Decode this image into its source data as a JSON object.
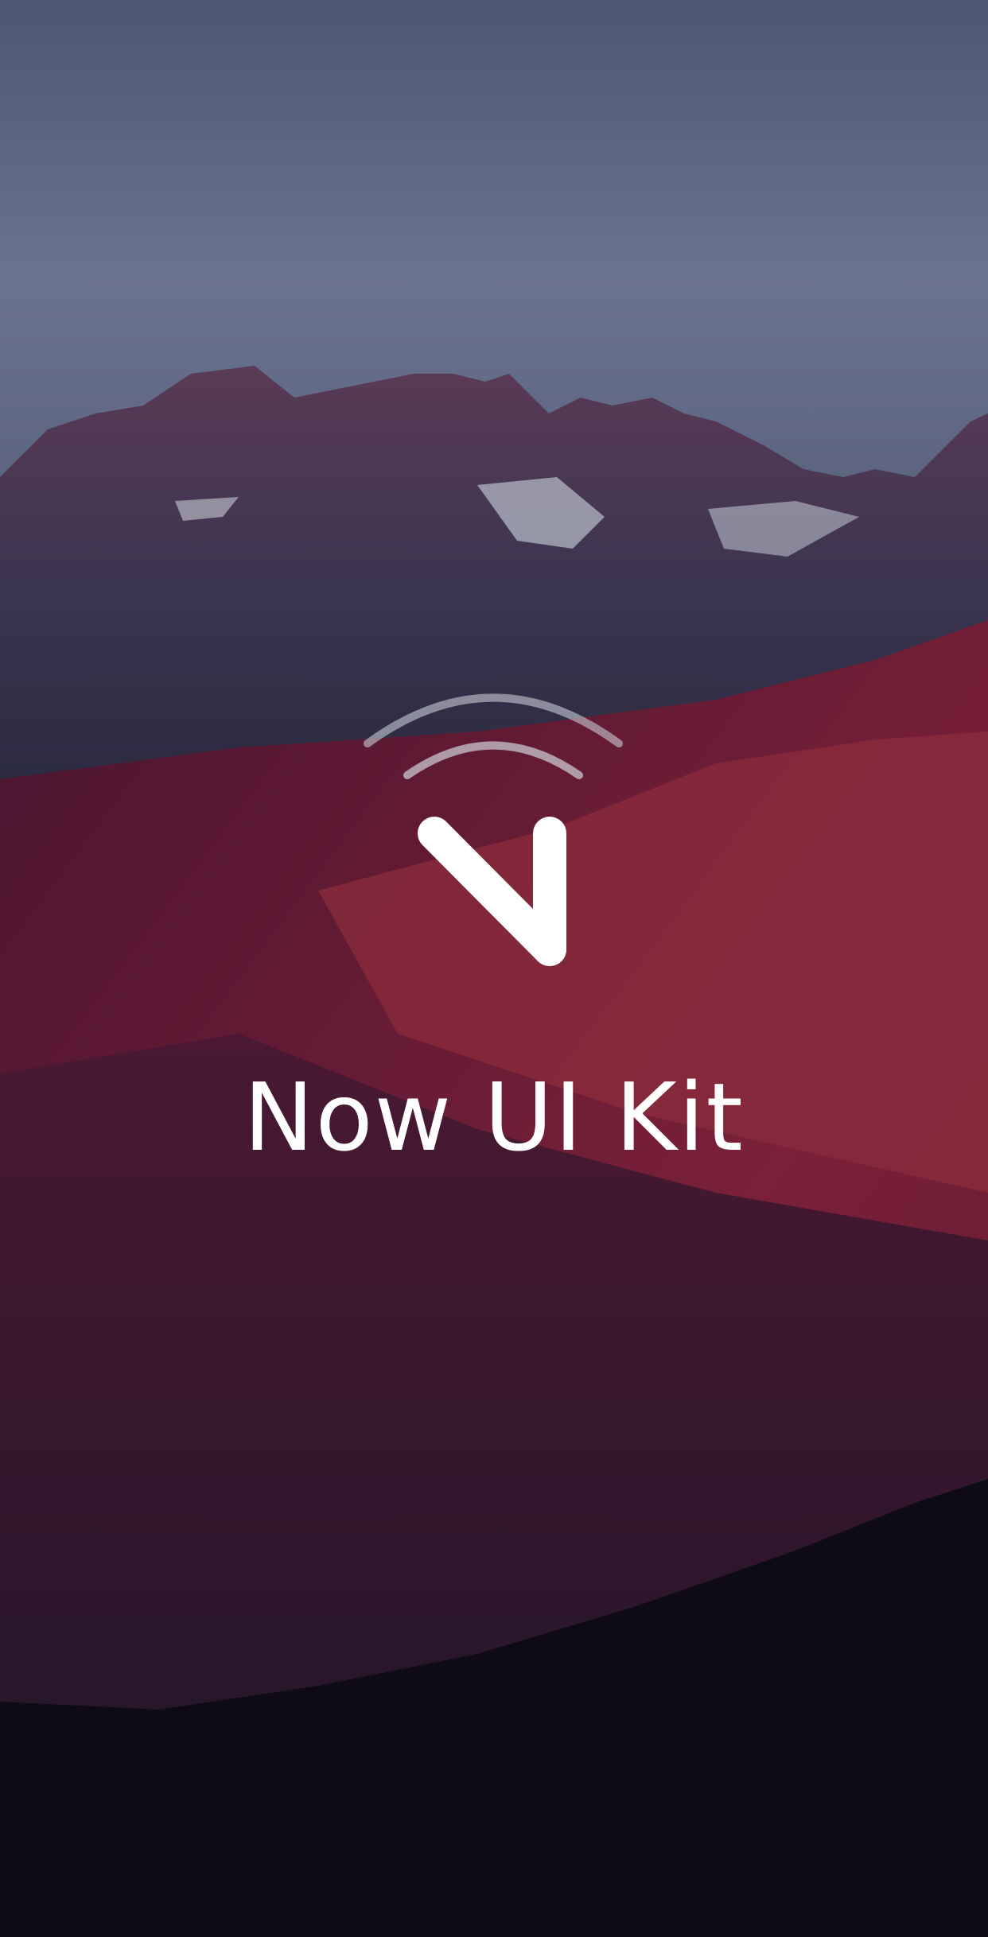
{
  "splash": {
    "title": "Now UI Kit",
    "logo_icon": "now-ui-n-logo-icon",
    "background": "mountain-landscape-photo",
    "colors": {
      "sky": "#5a6480",
      "mountain_red": "#7a1e3a",
      "text": "#ffffff"
    }
  }
}
